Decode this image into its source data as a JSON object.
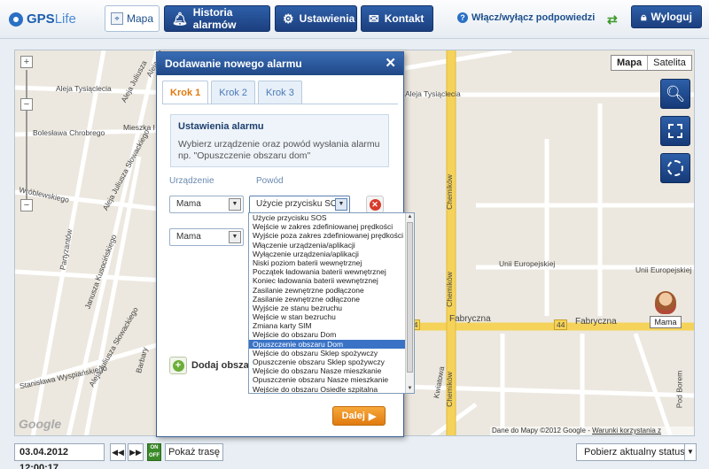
{
  "header": {
    "logo_main": "GPS",
    "logo_sub": "Life",
    "tabs": {
      "map": "Mapa",
      "alarm_history": "Historia alarmów",
      "settings": "Ustawienia",
      "contact": "Kontakt"
    },
    "help_toggle": "Włącz/wyłącz podpowiedzi",
    "logout": "Wyloguj"
  },
  "map": {
    "type_map": "Mapa",
    "type_satellite": "Satelita",
    "streets": {
      "s1": "Aleja Tysiąclecia",
      "s2": "Bolesława Chrobrego",
      "s3": "Mieszka I",
      "s4": "Aleja Juliusza Słowackiego",
      "s5": "Wróblewskiego",
      "s6": "Partyzantów",
      "s7": "Janusza Kusocińskiego",
      "s8": "Aleja Juliusza Słowackiego",
      "s9": "Stanisława Wyspiańskiego",
      "s10": "Barbary",
      "s11": "Chemików",
      "s12": "Chemików",
      "s13": "Chemików",
      "s14": "Fabryczna",
      "s15": "Fabryczna",
      "s16": "Unii Europejskiej",
      "s17": "Unii Europejskiej",
      "s18": "Kwiatowa",
      "s19": "Pod Borem",
      "s20": "Aleja Tysiąclecia",
      "s21": "Aleja Juliusza",
      "s22": "Aleja Jul",
      "road_num_a": "44",
      "road_num_b": "44"
    },
    "marker_label": "Mama",
    "google": "Google",
    "copyright_prefix": "Dane do Mapy ©2012 Google - ",
    "terms_link": "Warunki korzystania z programu"
  },
  "dialog": {
    "title": "Dodawanie nowego alarmu",
    "close": "✕",
    "steps": [
      "Krok 1",
      "Krok 2",
      "Krok 3"
    ],
    "info_title": "Ustawienia alarmu",
    "info_text": "Wybierz urządzenie oraz powód wysłania alarmu np. \"Opuszczenie obszaru dom\"",
    "col_device": "Urządzenie",
    "col_reason": "Powód",
    "row1_device": "Mama",
    "row1_reason": "Użycie przycisku SOS",
    "row2_device": "Mama",
    "add_area": "Dodaj obszar",
    "next": "Dalej"
  },
  "reason_options": [
    "Użycie przycisku SOS",
    "Wejście w zakres zdefiniowanej prędkości",
    "Wyjście poza zakres zdefiniowanej prędkości",
    "Włączenie urządzenia/aplikacji",
    "Wyłączenie urządzenia/aplikacji",
    "Niski poziom baterii wewnętrznej",
    "Początek ładowania baterii wewnętrznej",
    "Koniec ładowania baterii wewnętrznej",
    "Zasilanie zewnętrzne podłączone",
    "Zasilanie zewnętrzne odłączone",
    "Wyjście ze stanu bezruchu",
    "Wejście w stan bezruchu",
    "Zmiana karty SIM",
    "Wejście do obszaru Dom",
    "Opuszczenie obszaru Dom",
    "Wejście do obszaru Sklep spożywczy",
    "Opuszczenie obszaru Sklep spożywczy",
    "Wejście do obszaru Nasze mieszkanie",
    "Opuszczenie obszaru Nasze mieszkanie",
    "Wejście do obszaru Osiedle szpitalna"
  ],
  "selected_reason_index": 14,
  "footer": {
    "datetime": "03.04.2012 12:00:17",
    "prev": "◀◀",
    "next": "▶▶",
    "on": "ON",
    "off": "OFF",
    "show_route": "Pokaż trasę",
    "get_status": "Pobierz aktualny status",
    "status_arrow": "▼"
  }
}
